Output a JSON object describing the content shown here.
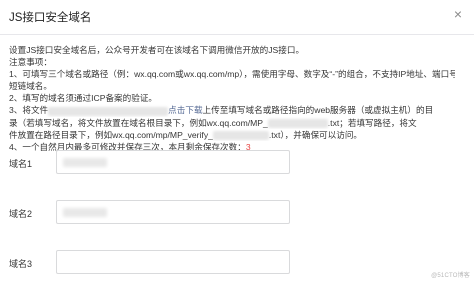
{
  "dialog": {
    "title": "JS接口安全域名",
    "close_symbol": "×"
  },
  "instructions": {
    "line1": "设置JS接口安全域名后，公众号开发者可在该域名下调用微信开放的JS接口。",
    "line2": "注意事项：",
    "line3": "1、可填写三个域名或路径（例：wx.qq.com或wx.qq.com/mp），需使用字母、数字及“-”的组合，不支持IP地址、端口号及",
    "line4": "短链域名。",
    "line5": "2、填写的域名须通过ICP备案的验证。",
    "line6_a": "3、将文件",
    "line6_link": "点击下载",
    "line6_b": "上传至填写域名或路径指向的web服务器（或虚拟主机）的目",
    "line7_a": "录（若填写域名，将文件放置在域名根目录下，例如wx.qq.com/MP_",
    "line7_b": ".txt；若填写路径，将文",
    "line8_a": "件放置在路径目录下，例如wx.qq.com/mp/MP_verify_",
    "line8_b": ".txt），并确保可以访问。",
    "line9_a": "4、一个自然月内最多可修改并保存三次，本月剩余保存次数：",
    "line9_count": "3"
  },
  "form": {
    "domain1_label": "域名1",
    "domain2_label": "域名2",
    "domain3_label": "域名3"
  },
  "watermark": "@51CTO博客"
}
